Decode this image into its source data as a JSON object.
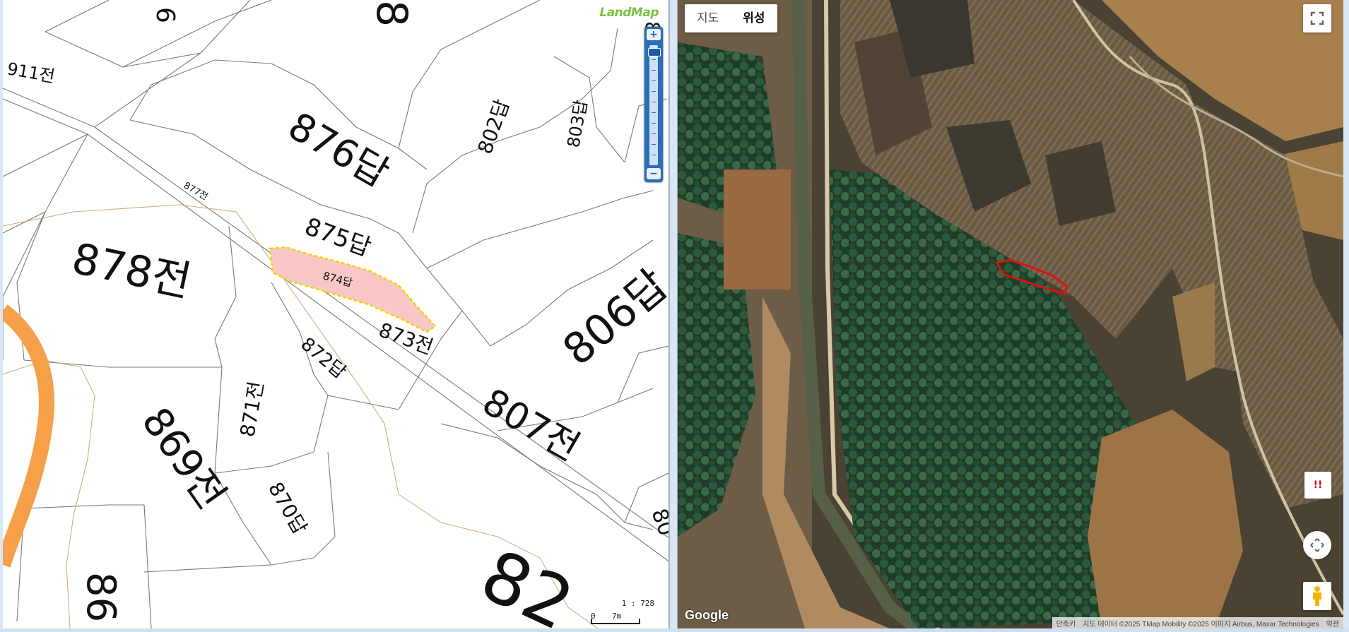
{
  "cadastral": {
    "logo": "LandMap",
    "zoom": {
      "plus": "+",
      "minus": "−"
    },
    "scale": {
      "ratio": "1 : 728",
      "zero": "0",
      "length": "7m"
    },
    "parcels": [
      {
        "label": "911전"
      },
      {
        "label": "876답"
      },
      {
        "label": "802답"
      },
      {
        "label": "803답"
      },
      {
        "label": "877전"
      },
      {
        "label": "875답"
      },
      {
        "label": "878전"
      },
      {
        "label": "874답"
      },
      {
        "label": "873전"
      },
      {
        "label": "806답"
      },
      {
        "label": "872답"
      },
      {
        "label": "871전"
      },
      {
        "label": "869전"
      },
      {
        "label": "807전"
      },
      {
        "label": "870답"
      },
      {
        "label": "86"
      },
      {
        "label": "82"
      },
      {
        "label": "80"
      },
      {
        "label": "6"
      },
      {
        "label": "8"
      },
      {
        "label": "8"
      }
    ],
    "highlight_parcel": "874답",
    "colors": {
      "highlight_fill": "#f8c8c8",
      "highlight_border": "#f2d200",
      "road": "#f7a04a",
      "logo": "#7bc142"
    }
  },
  "satellite": {
    "map_type": {
      "map": "지도",
      "satellite": "위성",
      "selected": "위성"
    },
    "google_logo": "Google",
    "attribution": {
      "shortcuts": "단축키",
      "data": "지도 데이터 ©2025 TMap Mobility ©2025 이미지 Airbus, Maxar Technologies",
      "terms": "약관"
    },
    "report_button": "!!",
    "colors": {
      "outline": "#e01010"
    }
  }
}
